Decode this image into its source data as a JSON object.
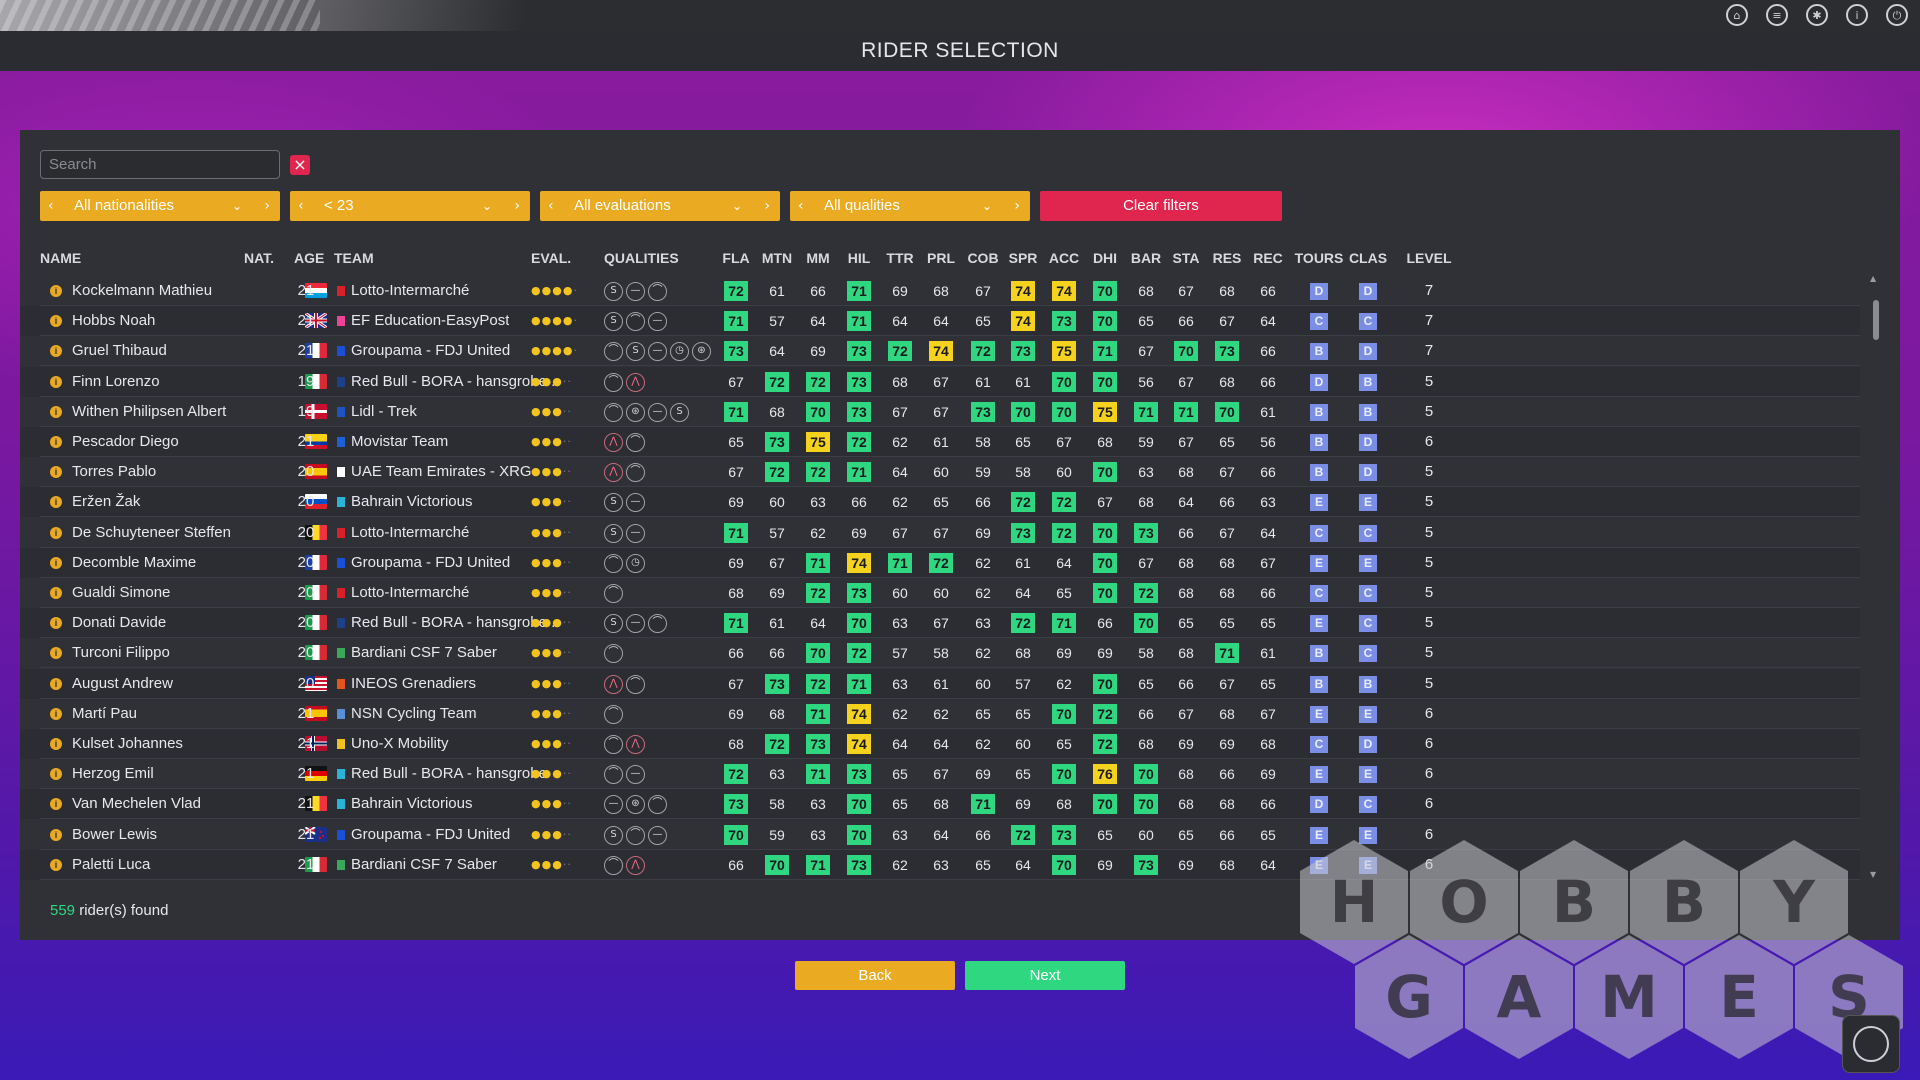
{
  "header": {
    "title": "RIDER SELECTION",
    "icons": [
      "home-icon",
      "list-icon",
      "settings-icon",
      "info-icon",
      "power-icon"
    ]
  },
  "search": {
    "placeholder": "Search",
    "value": ""
  },
  "filters": {
    "nationality": "All nationalities",
    "age": "< 23",
    "evaluation": "All evaluations",
    "qualities": "All qualities",
    "clear_label": "Clear filters"
  },
  "columns": [
    "NAME",
    "NAT.",
    "AGE",
    "TEAM",
    "EVAL.",
    "QUALITIES",
    "FLA",
    "MTN",
    "MM",
    "HIL",
    "TTR",
    "PRL",
    "COB",
    "SPR",
    "ACC",
    "DHI",
    "BAR",
    "STA",
    "RES",
    "REC",
    "TOURS",
    "CLAS",
    "LEVEL"
  ],
  "stat_keys": [
    "FLA",
    "MTN",
    "MM",
    "HIL",
    "TTR",
    "PRL",
    "COB",
    "SPR",
    "ACC",
    "DHI",
    "BAR",
    "STA",
    "RES",
    "REC"
  ],
  "highlight_colors": {
    "green": "#2fd880",
    "yellow": "#f5d21e",
    "grade": "#7a8ee6",
    "accent_orange": "#eaaa22",
    "accent_red": "#e0264f"
  },
  "riders": [
    {
      "name": "Kockelmann Mathieu",
      "nat": "lux",
      "age": "21",
      "team": "Lotto-Intermarché",
      "team_color": "#d81f2a",
      "stars": 4,
      "qualities": [
        "sprint",
        "flat",
        "hill"
      ],
      "stats": [
        72,
        61,
        66,
        71,
        69,
        68,
        67,
        74,
        74,
        70,
        68,
        67,
        68,
        66
      ],
      "hl": [
        "g",
        "",
        "",
        "g",
        "",
        "",
        "",
        "y",
        "y",
        "g",
        "",
        "",
        "",
        ""
      ],
      "tours": "D",
      "clas": "D",
      "level": "7"
    },
    {
      "name": "Hobbs Noah",
      "nat": "gbr",
      "age": "21",
      "team": "EF Education-EasyPost",
      "team_color": "#f1429a",
      "stars": 4,
      "qualities": [
        "sprint",
        "hill",
        "flat"
      ],
      "stats": [
        71,
        57,
        64,
        71,
        64,
        64,
        65,
        74,
        73,
        70,
        65,
        66,
        67,
        64
      ],
      "hl": [
        "g",
        "",
        "",
        "g",
        "",
        "",
        "",
        "y",
        "g",
        "g",
        "",
        "",
        "",
        ""
      ],
      "tours": "C",
      "clas": "C",
      "level": "7"
    },
    {
      "name": "Gruel Thibaud",
      "nat": "fra",
      "age": "21",
      "team": "Groupama - FDJ United",
      "team_color": "#1c4fd8",
      "stars": 4,
      "qualities": [
        "hill",
        "sprint",
        "flat",
        "timetrial",
        "cobbles"
      ],
      "stats": [
        73,
        64,
        69,
        73,
        72,
        74,
        72,
        73,
        75,
        71,
        67,
        70,
        73,
        66
      ],
      "hl": [
        "g",
        "",
        "",
        "g",
        "g",
        "y",
        "g",
        "g",
        "y",
        "g",
        "",
        "g",
        "g",
        ""
      ],
      "tours": "B",
      "clas": "D",
      "level": "7"
    },
    {
      "name": "Finn Lorenzo",
      "nat": "ita",
      "age": "19",
      "team": "Red Bull - BORA - hansgrohe ..",
      "team_color": "#1e3f8a",
      "stars": 3,
      "qualities": [
        "hill",
        "mountain"
      ],
      "stats": [
        67,
        72,
        72,
        73,
        68,
        67,
        61,
        61,
        70,
        70,
        56,
        67,
        68,
        66
      ],
      "hl": [
        "",
        "g",
        "g",
        "g",
        "",
        "",
        "",
        "",
        "g",
        "g",
        "",
        "",
        "",
        ""
      ],
      "tours": "D",
      "clas": "B",
      "level": "5"
    },
    {
      "name": "Withen Philipsen Albert",
      "nat": "den",
      "age": "19",
      "team": "Lidl - Trek",
      "team_color": "#1e53c4",
      "stars": 3,
      "qualities": [
        "hill",
        "cobbles",
        "flat",
        "sprint"
      ],
      "stats": [
        71,
        68,
        70,
        73,
        67,
        67,
        73,
        70,
        70,
        75,
        71,
        71,
        70,
        61
      ],
      "hl": [
        "g",
        "",
        "g",
        "g",
        "",
        "",
        "g",
        "g",
        "g",
        "y",
        "g",
        "g",
        "g",
        ""
      ],
      "tours": "B",
      "clas": "B",
      "level": "5"
    },
    {
      "name": "Pescador Diego",
      "nat": "col",
      "age": "21",
      "team": "Movistar Team",
      "team_color": "#1f5fd6",
      "stars": 3,
      "qualities": [
        "mountain",
        "hill"
      ],
      "stats": [
        65,
        73,
        75,
        72,
        62,
        61,
        58,
        65,
        67,
        68,
        59,
        67,
        65,
        56
      ],
      "hl": [
        "",
        "g",
        "y",
        "g",
        "",
        "",
        "",
        "",
        "",
        "",
        "",
        "",
        "",
        ""
      ],
      "tours": "B",
      "clas": "D",
      "level": "6"
    },
    {
      "name": "Torres Pablo",
      "nat": "esp",
      "age": "20",
      "team": "UAE Team Emirates - XRG",
      "team_color": "#ffffff",
      "stars": 3,
      "qualities": [
        "mountain",
        "hill"
      ],
      "stats": [
        67,
        72,
        72,
        71,
        64,
        60,
        59,
        58,
        60,
        70,
        63,
        68,
        67,
        66
      ],
      "hl": [
        "",
        "g",
        "g",
        "g",
        "",
        "",
        "",
        "",
        "",
        "g",
        "",
        "",
        "",
        ""
      ],
      "tours": "B",
      "clas": "D",
      "level": "5"
    },
    {
      "name": "Eržen Žak",
      "nat": "slo",
      "age": "20",
      "team": "Bahrain Victorious",
      "team_color": "#2ab3d9",
      "stars": 3,
      "qualities": [
        "sprint",
        "flat"
      ],
      "stats": [
        69,
        60,
        63,
        66,
        62,
        65,
        66,
        72,
        72,
        67,
        68,
        64,
        66,
        63
      ],
      "hl": [
        "",
        "",
        "",
        "",
        "",
        "",
        "",
        "g",
        "g",
        "",
        "",
        "",
        "",
        ""
      ],
      "tours": "E",
      "clas": "E",
      "level": "5"
    },
    {
      "name": "De Schuyteneer Steffen",
      "nat": "bel",
      "age": "20",
      "team": "Lotto-Intermarché",
      "team_color": "#d81f2a",
      "stars": 3,
      "qualities": [
        "sprint",
        "flat"
      ],
      "stats": [
        71,
        57,
        62,
        69,
        67,
        67,
        69,
        73,
        72,
        70,
        73,
        66,
        67,
        64
      ],
      "hl": [
        "g",
        "",
        "",
        "",
        "",
        "",
        "",
        "g",
        "g",
        "g",
        "g",
        "",
        "",
        ""
      ],
      "tours": "C",
      "clas": "C",
      "level": "5"
    },
    {
      "name": "Decomble Maxime",
      "nat": "fra",
      "age": "20",
      "team": "Groupama - FDJ United",
      "team_color": "#1c4fd8",
      "stars": 3,
      "qualities": [
        "hill",
        "timetrial"
      ],
      "stats": [
        69,
        67,
        71,
        74,
        71,
        72,
        62,
        61,
        64,
        70,
        67,
        68,
        68,
        67
      ],
      "hl": [
        "",
        "",
        "g",
        "y",
        "g",
        "g",
        "",
        "",
        "",
        "g",
        "",
        "",
        "",
        ""
      ],
      "tours": "E",
      "clas": "E",
      "level": "5"
    },
    {
      "name": "Gualdi Simone",
      "nat": "ita",
      "age": "20",
      "team": "Lotto-Intermarché",
      "team_color": "#d81f2a",
      "stars": 3,
      "qualities": [
        "hill"
      ],
      "stats": [
        68,
        69,
        72,
        73,
        60,
        60,
        62,
        64,
        65,
        70,
        72,
        68,
        68,
        66
      ],
      "hl": [
        "",
        "",
        "g",
        "g",
        "",
        "",
        "",
        "",
        "",
        "g",
        "g",
        "",
        "",
        ""
      ],
      "tours": "C",
      "clas": "C",
      "level": "5"
    },
    {
      "name": "Donati Davide",
      "nat": "ita",
      "age": "20",
      "team": "Red Bull - BORA - hansgrohe ..",
      "team_color": "#1e3f8a",
      "stars": 3,
      "qualities": [
        "sprint",
        "flat",
        "hill"
      ],
      "stats": [
        71,
        61,
        64,
        70,
        63,
        67,
        63,
        72,
        71,
        66,
        70,
        65,
        65,
        65
      ],
      "hl": [
        "g",
        "",
        "",
        "g",
        "",
        "",
        "",
        "g",
        "g",
        "",
        "g",
        "",
        "",
        ""
      ],
      "tours": "E",
      "clas": "C",
      "level": "5"
    },
    {
      "name": "Turconi Filippo",
      "nat": "ita",
      "age": "20",
      "team": "Bardiani CSF 7 Saber",
      "team_color": "#3aa85a",
      "stars": 3,
      "qualities": [
        "hill"
      ],
      "stats": [
        66,
        66,
        70,
        72,
        57,
        58,
        62,
        68,
        69,
        69,
        58,
        68,
        71,
        61
      ],
      "hl": [
        "",
        "",
        "g",
        "g",
        "",
        "",
        "",
        "",
        "",
        "",
        "",
        "",
        "g",
        ""
      ],
      "tours": "B",
      "clas": "C",
      "level": "5"
    },
    {
      "name": "August Andrew",
      "nat": "usa",
      "age": "20",
      "team": "INEOS Grenadiers",
      "team_color": "#e8541e",
      "stars": 3,
      "qualities": [
        "mountain",
        "hill"
      ],
      "stats": [
        67,
        73,
        72,
        71,
        63,
        61,
        60,
        57,
        62,
        70,
        65,
        66,
        67,
        65
      ],
      "hl": [
        "",
        "g",
        "g",
        "g",
        "",
        "",
        "",
        "",
        "",
        "g",
        "",
        "",
        "",
        ""
      ],
      "tours": "B",
      "clas": "B",
      "level": "5"
    },
    {
      "name": "Martí Pau",
      "nat": "esp",
      "age": "21",
      "team": "NSN Cycling Team",
      "team_color": "#5a8fd8",
      "stars": 3,
      "qualities": [
        "hill"
      ],
      "stats": [
        69,
        68,
        71,
        74,
        62,
        62,
        65,
        65,
        70,
        72,
        66,
        67,
        68,
        67
      ],
      "hl": [
        "",
        "",
        "g",
        "y",
        "",
        "",
        "",
        "",
        "g",
        "g",
        "",
        "",
        "",
        ""
      ],
      "tours": "E",
      "clas": "E",
      "level": "6"
    },
    {
      "name": "Kulset Johannes",
      "nat": "nor",
      "age": "21",
      "team": "Uno-X Mobility",
      "team_color": "#f0c020",
      "stars": 3,
      "qualities": [
        "hill",
        "mountain"
      ],
      "stats": [
        68,
        72,
        73,
        74,
        64,
        64,
        62,
        60,
        65,
        72,
        68,
        69,
        69,
        68
      ],
      "hl": [
        "",
        "g",
        "g",
        "y",
        "",
        "",
        "",
        "",
        "",
        "g",
        "",
        "",
        "",
        ""
      ],
      "tours": "C",
      "clas": "D",
      "level": "6"
    },
    {
      "name": "Herzog Emil",
      "nat": "ger",
      "age": "21",
      "team": "Red Bull - BORA - hansgrohe",
      "team_color": "#2ab3d9",
      "stars": 3,
      "qualities": [
        "hill",
        "flat"
      ],
      "stats": [
        72,
        63,
        71,
        73,
        65,
        67,
        69,
        65,
        70,
        76,
        70,
        68,
        66,
        69
      ],
      "hl": [
        "g",
        "",
        "g",
        "g",
        "",
        "",
        "",
        "",
        "g",
        "y",
        "g",
        "",
        "",
        ""
      ],
      "tours": "E",
      "clas": "E",
      "level": "6"
    },
    {
      "name": "Van Mechelen Vlad",
      "nat": "bel",
      "age": "21",
      "team": "Bahrain Victorious",
      "team_color": "#2ab3d9",
      "stars": 3,
      "qualities": [
        "flat",
        "cobbles",
        "hill"
      ],
      "stats": [
        73,
        58,
        63,
        70,
        65,
        68,
        71,
        69,
        68,
        70,
        70,
        68,
        68,
        66
      ],
      "hl": [
        "g",
        "",
        "",
        "g",
        "",
        "",
        "g",
        "",
        "",
        "g",
        "g",
        "",
        "",
        ""
      ],
      "tours": "D",
      "clas": "C",
      "level": "6"
    },
    {
      "name": "Bower Lewis",
      "nat": "nzl",
      "age": "21",
      "team": "Groupama - FDJ United",
      "team_color": "#1c4fd8",
      "stars": 3,
      "qualities": [
        "sprint",
        "hill",
        "flat"
      ],
      "stats": [
        70,
        59,
        63,
        70,
        63,
        64,
        66,
        72,
        73,
        65,
        60,
        65,
        66,
        65
      ],
      "hl": [
        "g",
        "",
        "",
        "g",
        "",
        "",
        "",
        "g",
        "g",
        "",
        "",
        "",
        "",
        ""
      ],
      "tours": "E",
      "clas": "E",
      "level": "6"
    },
    {
      "name": "Paletti Luca",
      "nat": "ita",
      "age": "21",
      "team": "Bardiani CSF 7 Saber",
      "team_color": "#3aa85a",
      "stars": 3,
      "qualities": [
        "hill",
        "mountain"
      ],
      "stats": [
        66,
        70,
        71,
        73,
        62,
        63,
        65,
        64,
        70,
        69,
        73,
        69,
        68,
        64
      ],
      "hl": [
        "",
        "g",
        "g",
        "g",
        "",
        "",
        "",
        "",
        "g",
        "",
        "g",
        "",
        "",
        ""
      ],
      "tours": "E",
      "clas": "E",
      "level": "6"
    }
  ],
  "footer": {
    "count": "559",
    "found_label": "rider(s) found"
  },
  "buttons": {
    "back": "Back",
    "next": "Next"
  },
  "watermark": {
    "row1": [
      "H",
      "O",
      "B",
      "B",
      "Y"
    ],
    "row2": [
      "G",
      "A",
      "M",
      "E",
      "S"
    ]
  }
}
